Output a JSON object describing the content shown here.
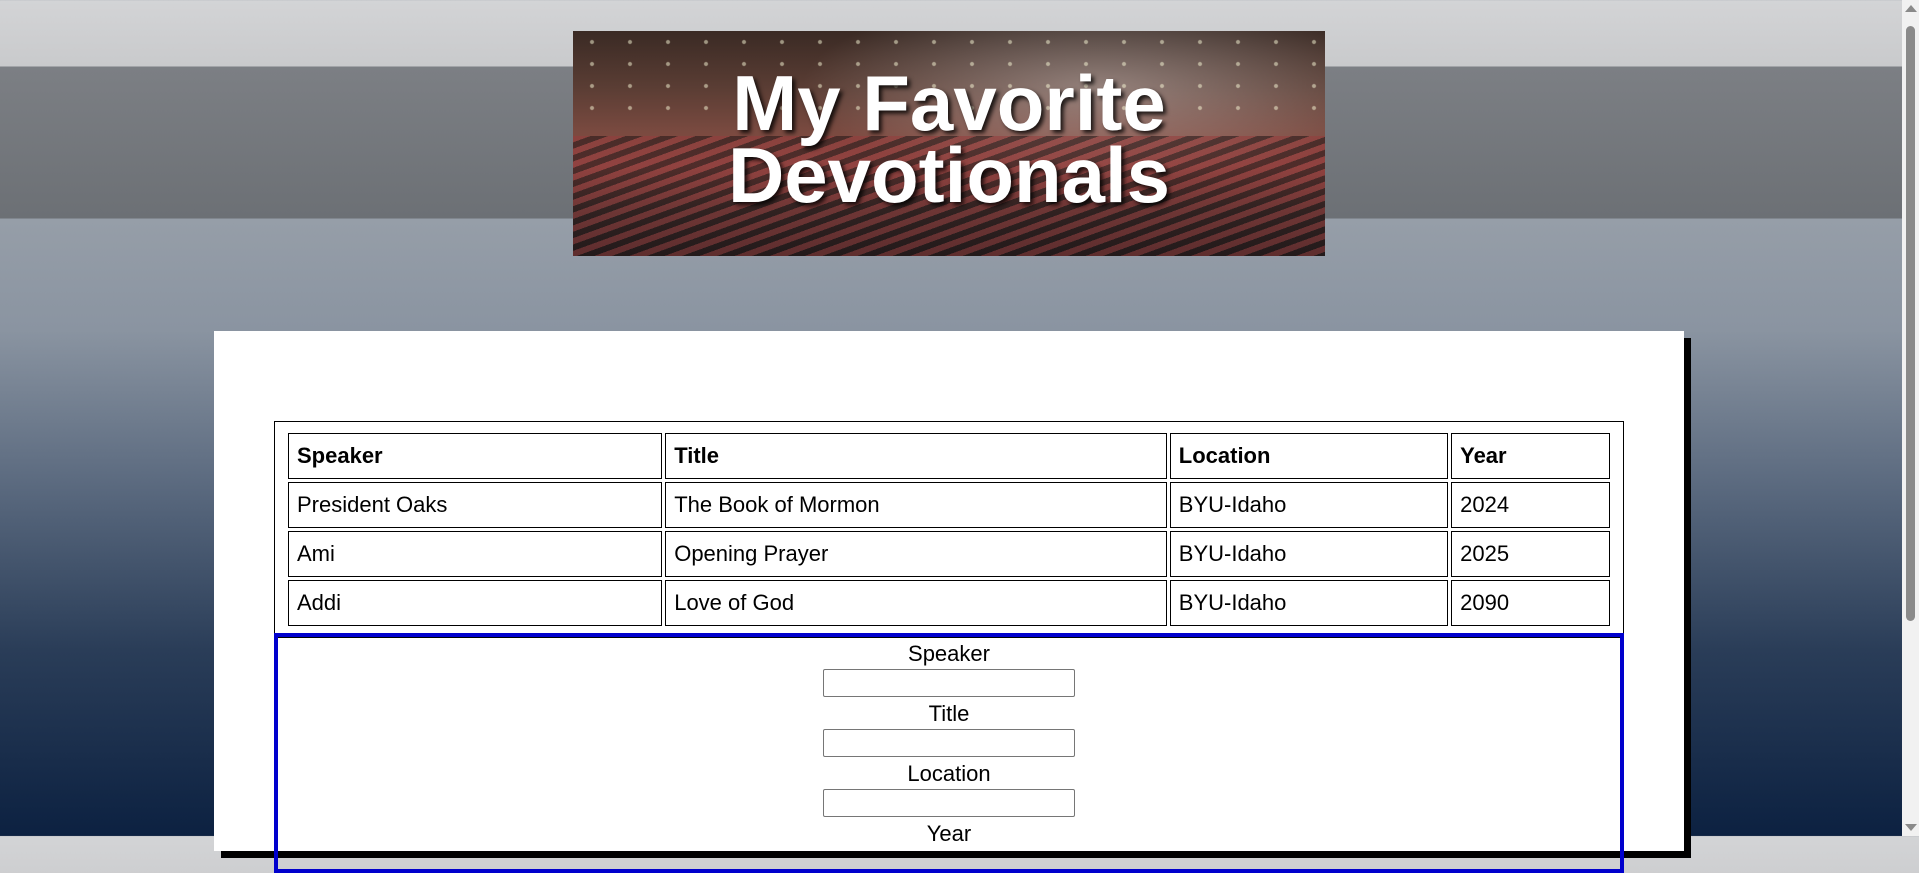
{
  "header": {
    "title_line1": "My Favorite",
    "title_line2": "Devotionals"
  },
  "table": {
    "headers": [
      "Speaker",
      "Title",
      "Location",
      "Year"
    ],
    "rows": [
      [
        "President Oaks",
        "The Book of Mormon",
        "BYU-Idaho",
        "2024"
      ],
      [
        "Ami",
        "Opening Prayer",
        "BYU-Idaho",
        "2025"
      ],
      [
        "Addi",
        "Love of God",
        "BYU-Idaho",
        "2090"
      ]
    ]
  },
  "form": {
    "speaker_label": "Speaker",
    "speaker_value": "",
    "title_label": "Title",
    "title_value": "",
    "location_label": "Location",
    "location_value": "",
    "year_label": "Year"
  },
  "colors": {
    "form_border": "#0000cd",
    "card_shadow": "#000000"
  }
}
